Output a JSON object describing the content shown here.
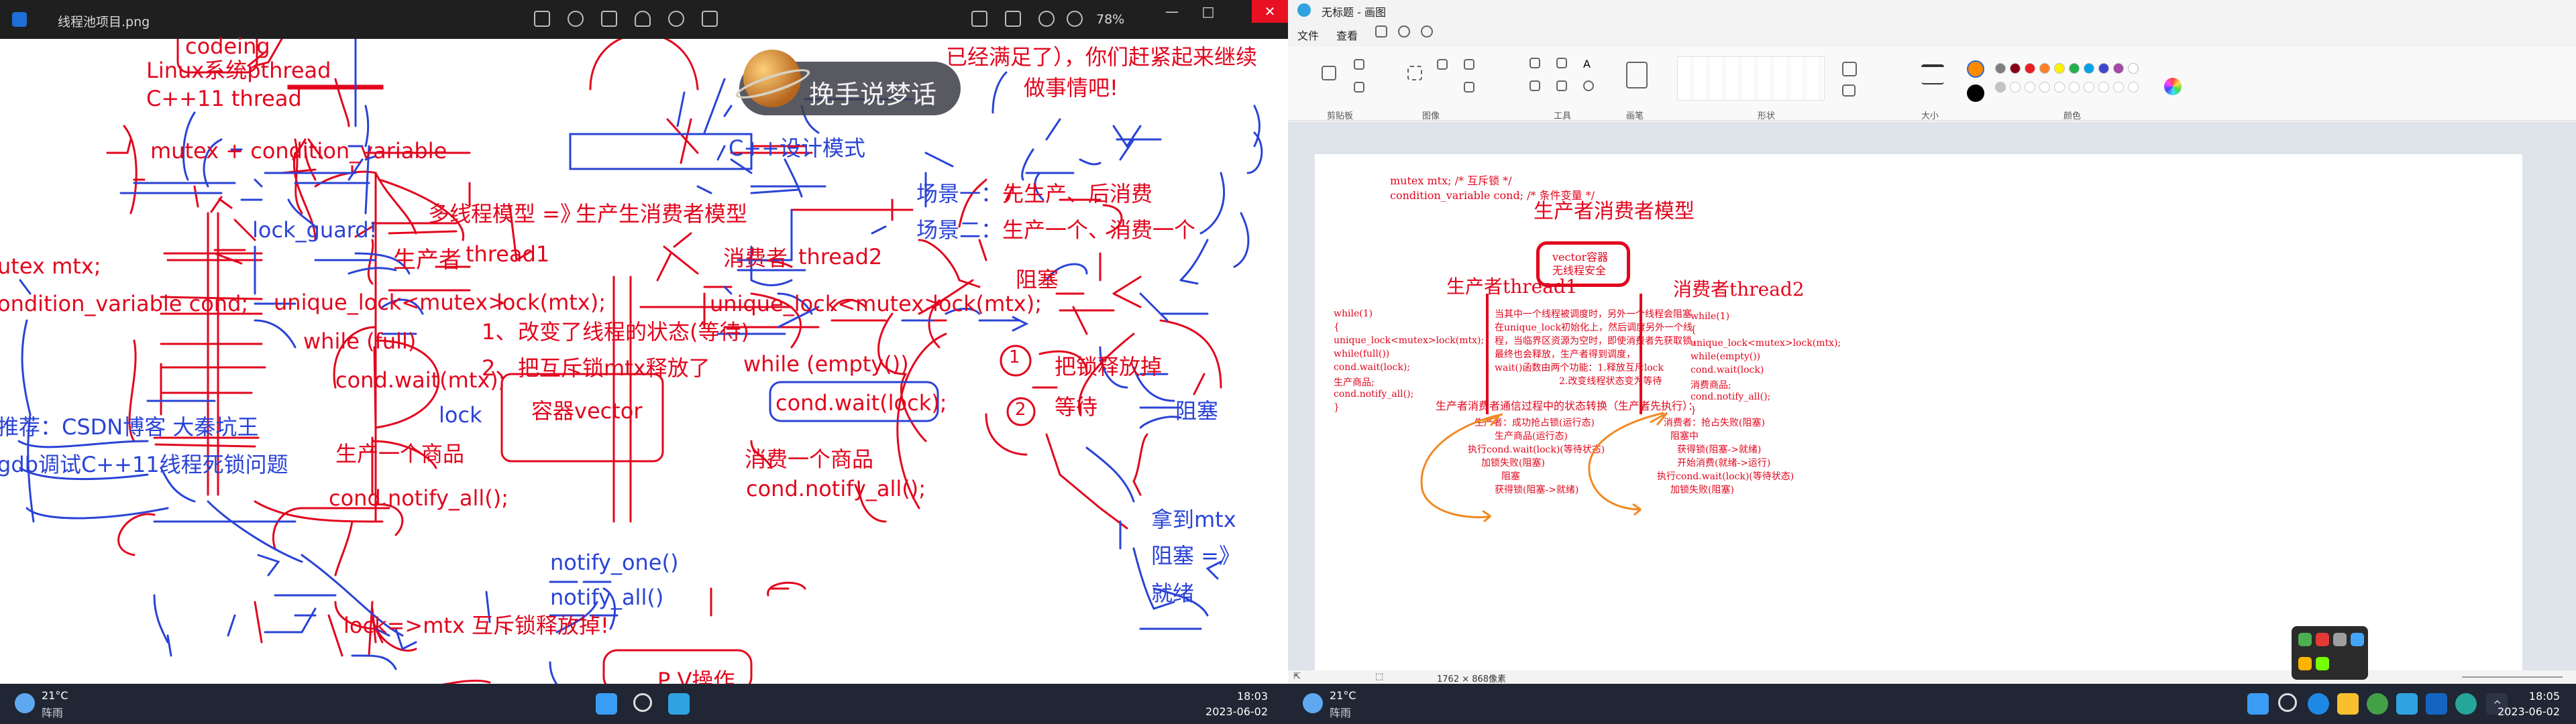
{
  "left_screen": {
    "viewer": {
      "filename": "线程池项目.png",
      "zoom": "78%"
    },
    "overlay": {
      "text": "挽手说梦话"
    },
    "notes": {
      "top_box_codeing": "codeing",
      "linux_pthread": "Linux系统pthread",
      "cpp11_thread": "C++11 thread",
      "mutex_condvar": "mutex + condition_variable",
      "top_right_fragment": "已经满足了），你们赶紧起来继续",
      "do_things": "做事情吧!",
      "cpp_design_pattern": "C++设计模式",
      "multithread_model": "多线程模型 =》",
      "producer_consumer_model": "生产生消费者模型",
      "scene1_label": "场景一：",
      "scene1_text": "先生产、后消费",
      "scene2_label": "场景二：",
      "scene2_text": "生产一个、消费一个",
      "lock_guard": "lock_guard!",
      "mutex_mtx": "utex mtx;",
      "condvar_cond": "ondition_variable cond;",
      "producer": "生产者",
      "thread1": "thread1",
      "consumer": "消费者",
      "thread2": "thread2",
      "unique_lock_left": "unique_lock<mutex>",
      "lock_mtx_left": "lock(mtx);",
      "unique_lock_right": "unique_lock<mutex>",
      "lock_mtx_right": "lock(mtx);",
      "blocked_top": "阻塞",
      "while_full": "while (full)",
      "step1_num": "1、",
      "step1_text": "改变了线程的状态(等待)",
      "step2_num": "2、",
      "step2_text": "把互斥锁mtx释放了",
      "cond_wait_mtx": "cond.wait(mtx);",
      "while_empty": "while (empty())",
      "cond_wait_lock": "cond.wait(lock);",
      "circle1": "1",
      "circle2": "2",
      "release_lock": "把锁释放掉",
      "waiting": "等待",
      "blocked_right": "阻塞",
      "lock_word": "lock",
      "container_vector": "容器vector",
      "recommend": "推荐：CSDN博客    大秦坑王",
      "gdb_debug": "gdb调试C++11线程死锁问题",
      "produce_one": "生产一个商品",
      "consume_one": "消费一个商品",
      "notify_all_left": "cond.notify_all();",
      "notify_all_right": "cond.notify_all();",
      "get_mtx": "拿到mtx",
      "blocked_arrow": "阻塞 =》",
      "ready": "就绪",
      "notify_one": "notify_one()",
      "notify_all": "notify_all()",
      "lock_release": "lock=>mtx 互斥锁释放掉!",
      "pv_op": "P V操作"
    },
    "taskbar": {
      "temp": "21°C",
      "condition": "阵雨",
      "time": "18:03",
      "date": "2023-06-02"
    }
  },
  "right_screen": {
    "paint": {
      "title": "无标题 - 画图",
      "menu": [
        "文件",
        "查看"
      ],
      "ribbon_groups": [
        "剪贴板",
        "图像",
        "工具",
        "画笔",
        "形状",
        "大小",
        "颜色"
      ],
      "colors": [
        "#ff8a00",
        "#000000",
        "#7f7f7f",
        "#880015",
        "#ed1c24",
        "#ff7f27",
        "#fff200",
        "#22b14c",
        "#00a2e8",
        "#3f48cc",
        "#a349a4",
        "#ffffff",
        "#c3c3c3",
        "#b97a57",
        "#ffaec9",
        "#ffc90e",
        "#efe4b0",
        "#b5e61d",
        "#99d9ea",
        "#7092be",
        "#c8bfe7"
      ],
      "status_size": "1762 × 868像素"
    },
    "doc": {
      "code_line1": "mutex mtx;  /* 互斥锁 */",
      "code_line2": "condition_variable cond;  /* 条件变量 */",
      "title": "生产者消费者模型",
      "vector_line1": "vector容器",
      "vector_line2": "无线程安全",
      "producer_title": "生产者thread1",
      "consumer_title": "消费者thread2",
      "left_code": [
        "while(1)",
        "{",
        "   unique_lock<mutex>lock(mtx);",
        "   while(full())",
        "       cond.wait(lock);",
        "   生产商品;",
        "   cond.notify_all();",
        "}"
      ],
      "right_code": [
        "while(1)",
        "{",
        "   unique_lock<mutex>lock(mtx);",
        "   while(empty())",
        "       cond.wait(lock)",
        "   消费商品;",
        "   cond.notify_all();",
        "}"
      ],
      "middle_text": [
        "当其中一个线程被调度时，另外一个线程会阻塞",
        "在unique_lock初始化上，然后调度另外一个线",
        "程，当临界区资源为空时，即使消费者先获取锁，",
        "最终也会释放，生产者得到调度，",
        "wait()函数由两个功能：1.释放互斥lock",
        "2.改变线程状态变为等待"
      ],
      "state_title": "生产者消费者通信过程中的状态转换（生产者先执行）：",
      "producer_states": [
        "生产者：成功抢占锁(运行态)",
        "生产商品(运行态)",
        "执行cond.wait(lock)(等待状态)",
        "加锁失败(阻塞)",
        "阻塞",
        "获得锁(阻塞->就绪)"
      ],
      "consumer_states": [
        "消费者：抢占失败(阻塞)",
        "阻塞中",
        "获得锁(阻塞->就绪)",
        "开始消费(就绪->运行)",
        "执行cond.wait(lock)(等待状态)",
        "加锁失败(阻塞)"
      ]
    },
    "taskbar": {
      "temp": "21°C",
      "condition": "阵雨",
      "time": "18:05",
      "date": "2023-06-02"
    }
  }
}
